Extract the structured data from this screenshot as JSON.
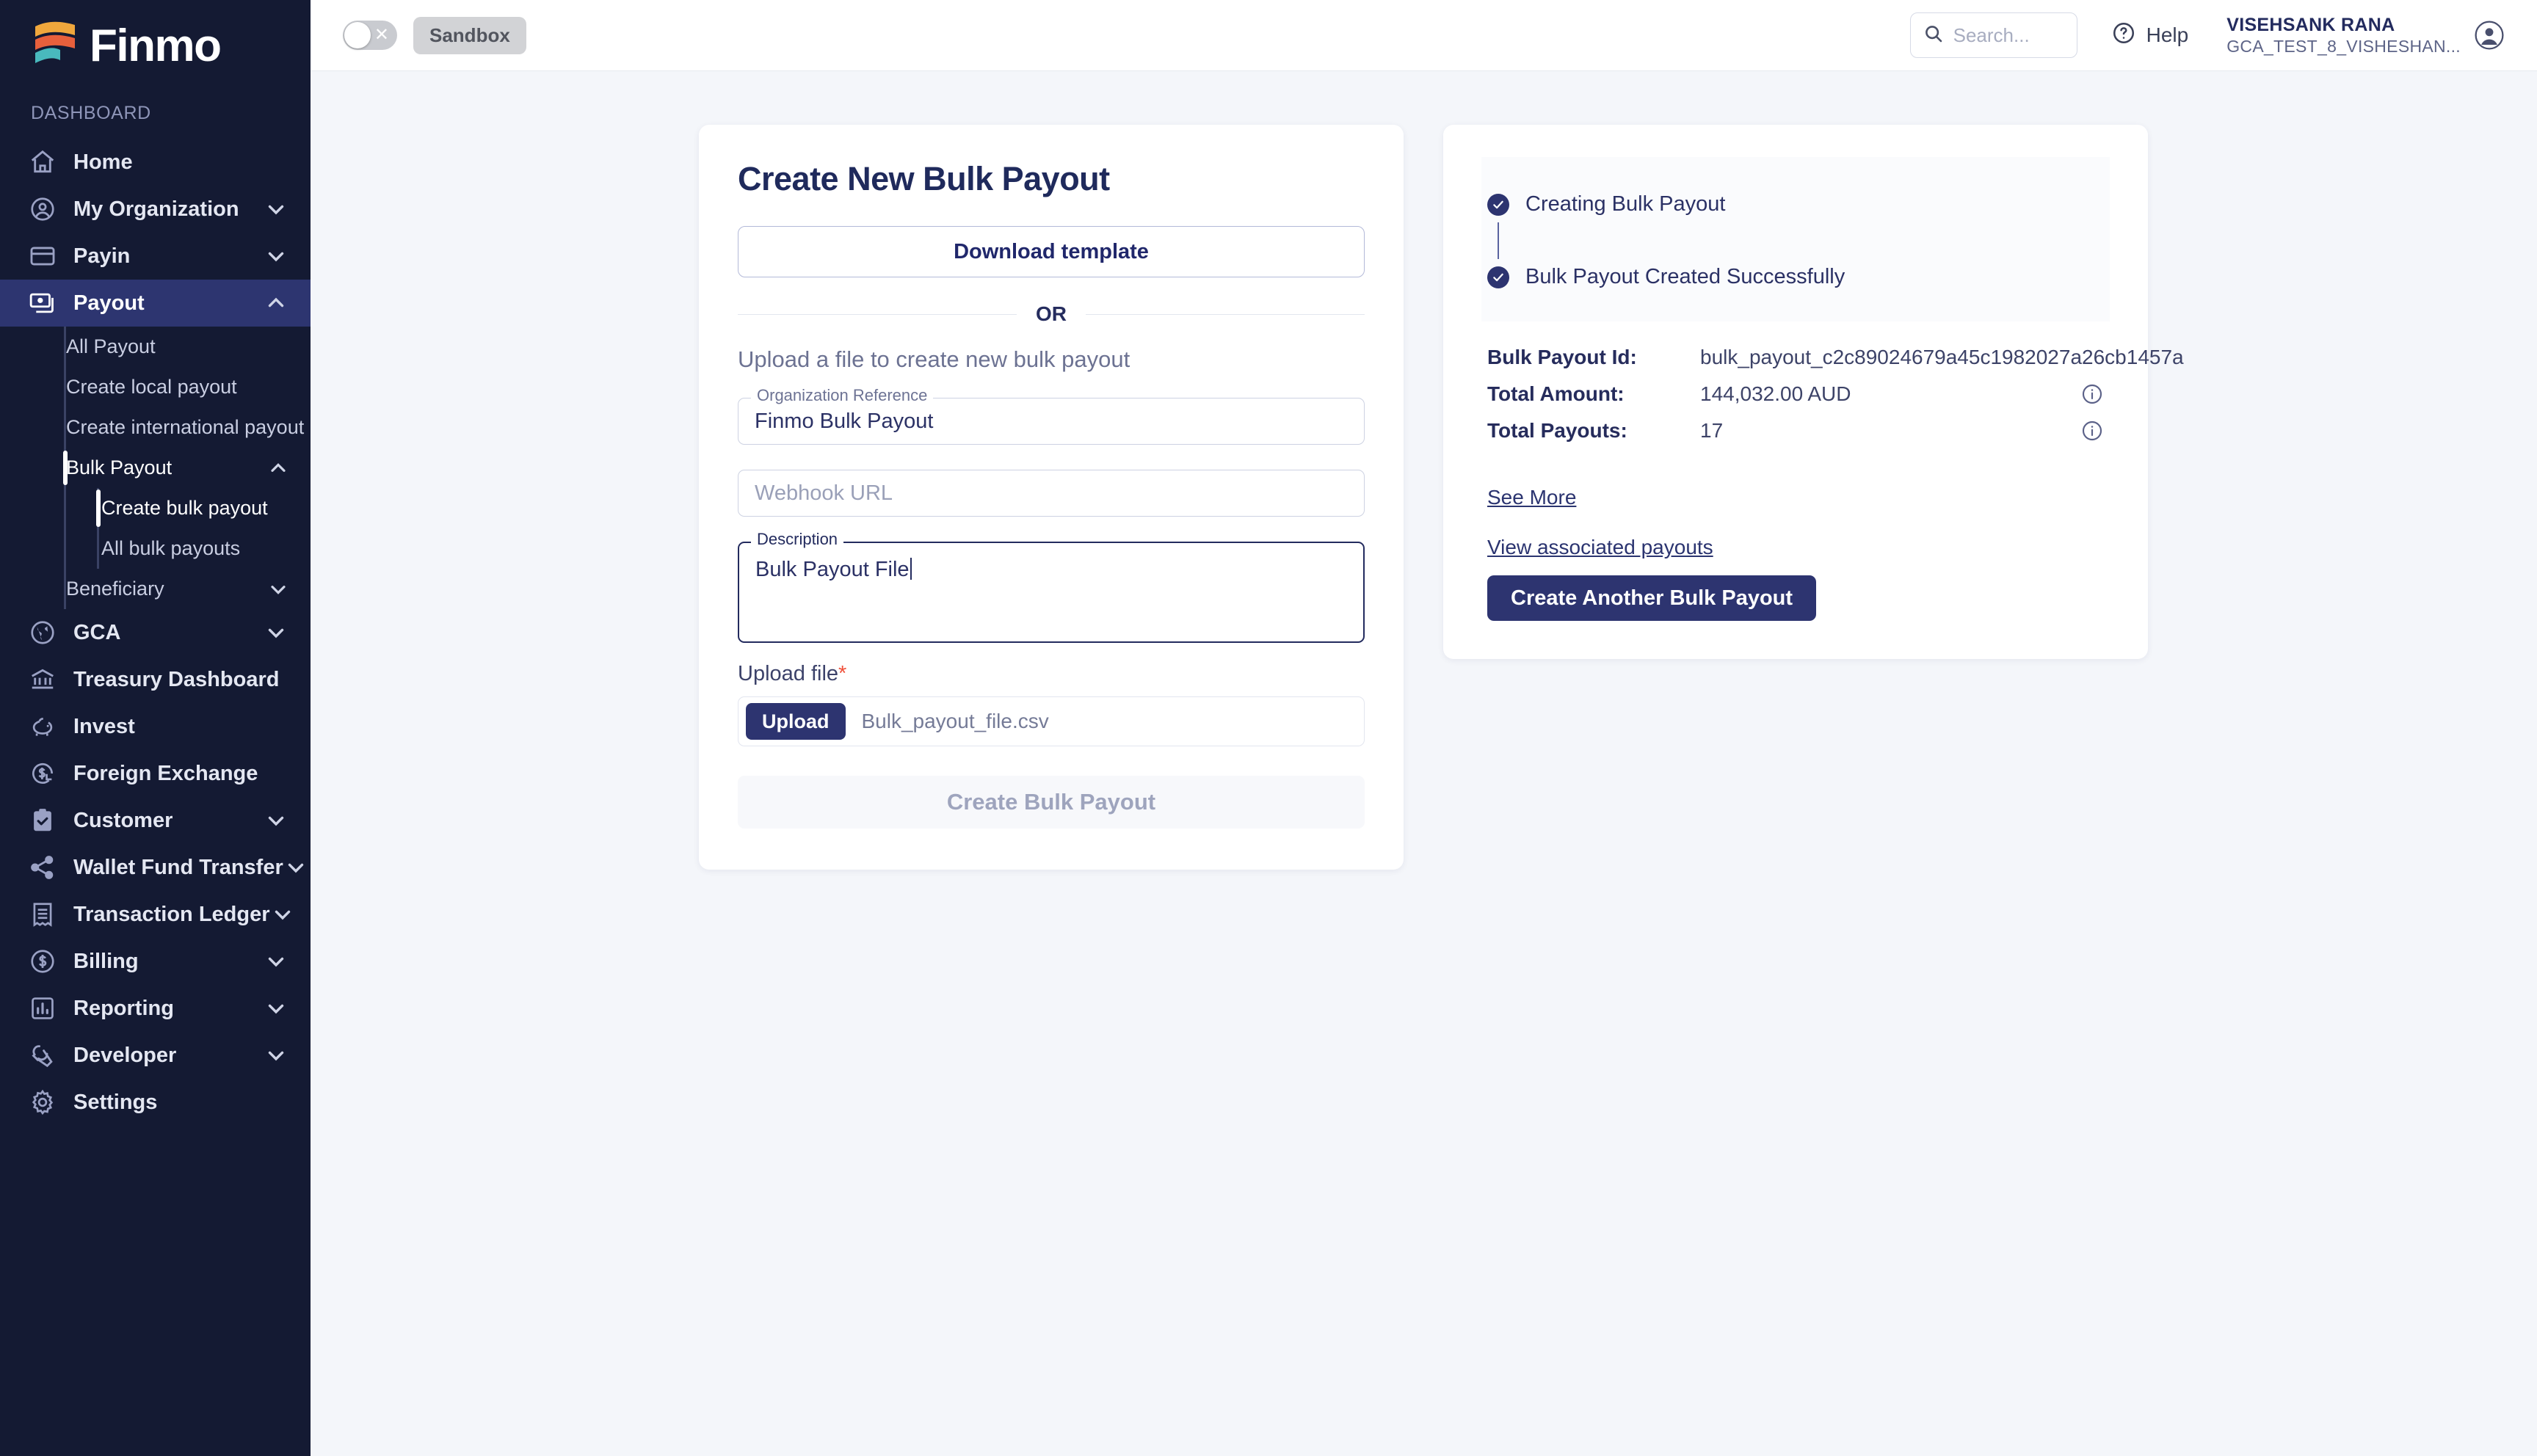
{
  "brand": {
    "name": "Finmo",
    "logo_colors": [
      "#f0a73c",
      "#e8603c",
      "#49b9bd"
    ],
    "sidebar_bg": "#141a33",
    "accent": "#2d3470"
  },
  "sidebar": {
    "section_title": "DASHBOARD",
    "items": [
      {
        "label": "Home",
        "icon": "home-icon",
        "expandable": false,
        "active": false
      },
      {
        "label": "My Organization",
        "icon": "user-circle-icon",
        "expandable": true,
        "active": false
      },
      {
        "label": "Payin",
        "icon": "card-icon",
        "expandable": true,
        "active": false
      },
      {
        "label": "Payout",
        "icon": "money-icon",
        "expandable": true,
        "active": true
      },
      {
        "label": "GCA",
        "icon": "globe-icon",
        "expandable": true,
        "active": false
      },
      {
        "label": "Treasury Dashboard",
        "icon": "bank-icon",
        "expandable": false,
        "active": false
      },
      {
        "label": "Invest",
        "icon": "piggy-bank-icon",
        "expandable": false,
        "active": false
      },
      {
        "label": "Foreign Exchange",
        "icon": "currency-exchange-icon",
        "expandable": false,
        "active": false
      },
      {
        "label": "Customer",
        "icon": "clipboard-check-icon",
        "expandable": true,
        "active": false
      },
      {
        "label": "Wallet Fund Transfer",
        "icon": "share-icon",
        "expandable": true,
        "active": false
      },
      {
        "label": "Transaction Ledger",
        "icon": "receipt-icon",
        "expandable": true,
        "active": false
      },
      {
        "label": "Billing",
        "icon": "dollar-circle-icon",
        "expandable": true,
        "active": false
      },
      {
        "label": "Reporting",
        "icon": "bar-chart-icon",
        "expandable": true,
        "active": false
      },
      {
        "label": "Developer",
        "icon": "wrench-icon",
        "expandable": true,
        "active": false
      },
      {
        "label": "Settings",
        "icon": "gear-icon",
        "expandable": false,
        "active": false
      }
    ],
    "payout_submenu": [
      {
        "label": "All Payout",
        "expandable": false,
        "selected": false
      },
      {
        "label": "Create local payout",
        "expandable": false,
        "selected": false
      },
      {
        "label": "Create international payout",
        "expandable": false,
        "selected": false
      },
      {
        "label": "Bulk Payout",
        "expandable": true,
        "selected": true
      },
      {
        "label": "Beneficiary",
        "expandable": true,
        "selected": false
      }
    ],
    "bulk_payout_submenu": [
      {
        "label": "Create bulk payout",
        "selected": true
      },
      {
        "label": "All bulk payouts",
        "selected": false
      }
    ]
  },
  "topbar": {
    "sandbox_label": "Sandbox",
    "sandbox_toggle_on": false,
    "search_placeholder": "Search...",
    "search_value": "",
    "help_label": "Help",
    "user_name": "VISEHSANK RANA",
    "user_org": "GCA_TEST_8_VISHESHAN..."
  },
  "form": {
    "title": "Create New Bulk Payout",
    "download_template_label": "Download template",
    "or_label": "OR",
    "upload_hint": "Upload a file to create new bulk payout",
    "org_reference": {
      "label": "Organization Reference",
      "value": "Finmo Bulk Payout"
    },
    "webhook": {
      "placeholder": "Webhook URL",
      "value": ""
    },
    "description": {
      "label": "Description",
      "value": "Bulk Payout File"
    },
    "upload_file": {
      "label": "Upload file",
      "required_marker": "*",
      "button_label": "Upload",
      "filename": "Bulk_payout_file.csv"
    },
    "submit_label": "Create Bulk Payout",
    "submit_disabled": true
  },
  "status": {
    "steps": [
      {
        "label": "Creating Bulk Payout",
        "done": true
      },
      {
        "label": "Bulk Payout Created Successfully",
        "done": true
      }
    ],
    "details": [
      {
        "key": "Bulk Payout Id:",
        "value": "bulk_payout_c2c89024679a45c1982027a26cb1457a",
        "info": false
      },
      {
        "key": "Total Amount:",
        "value": "144,032.00 AUD",
        "info": true
      },
      {
        "key": "Total Payouts:",
        "value": "17",
        "info": true
      }
    ],
    "see_more_label": "See More",
    "view_associated_label": "View associated payouts",
    "create_another_label": "Create Another Bulk Payout"
  }
}
